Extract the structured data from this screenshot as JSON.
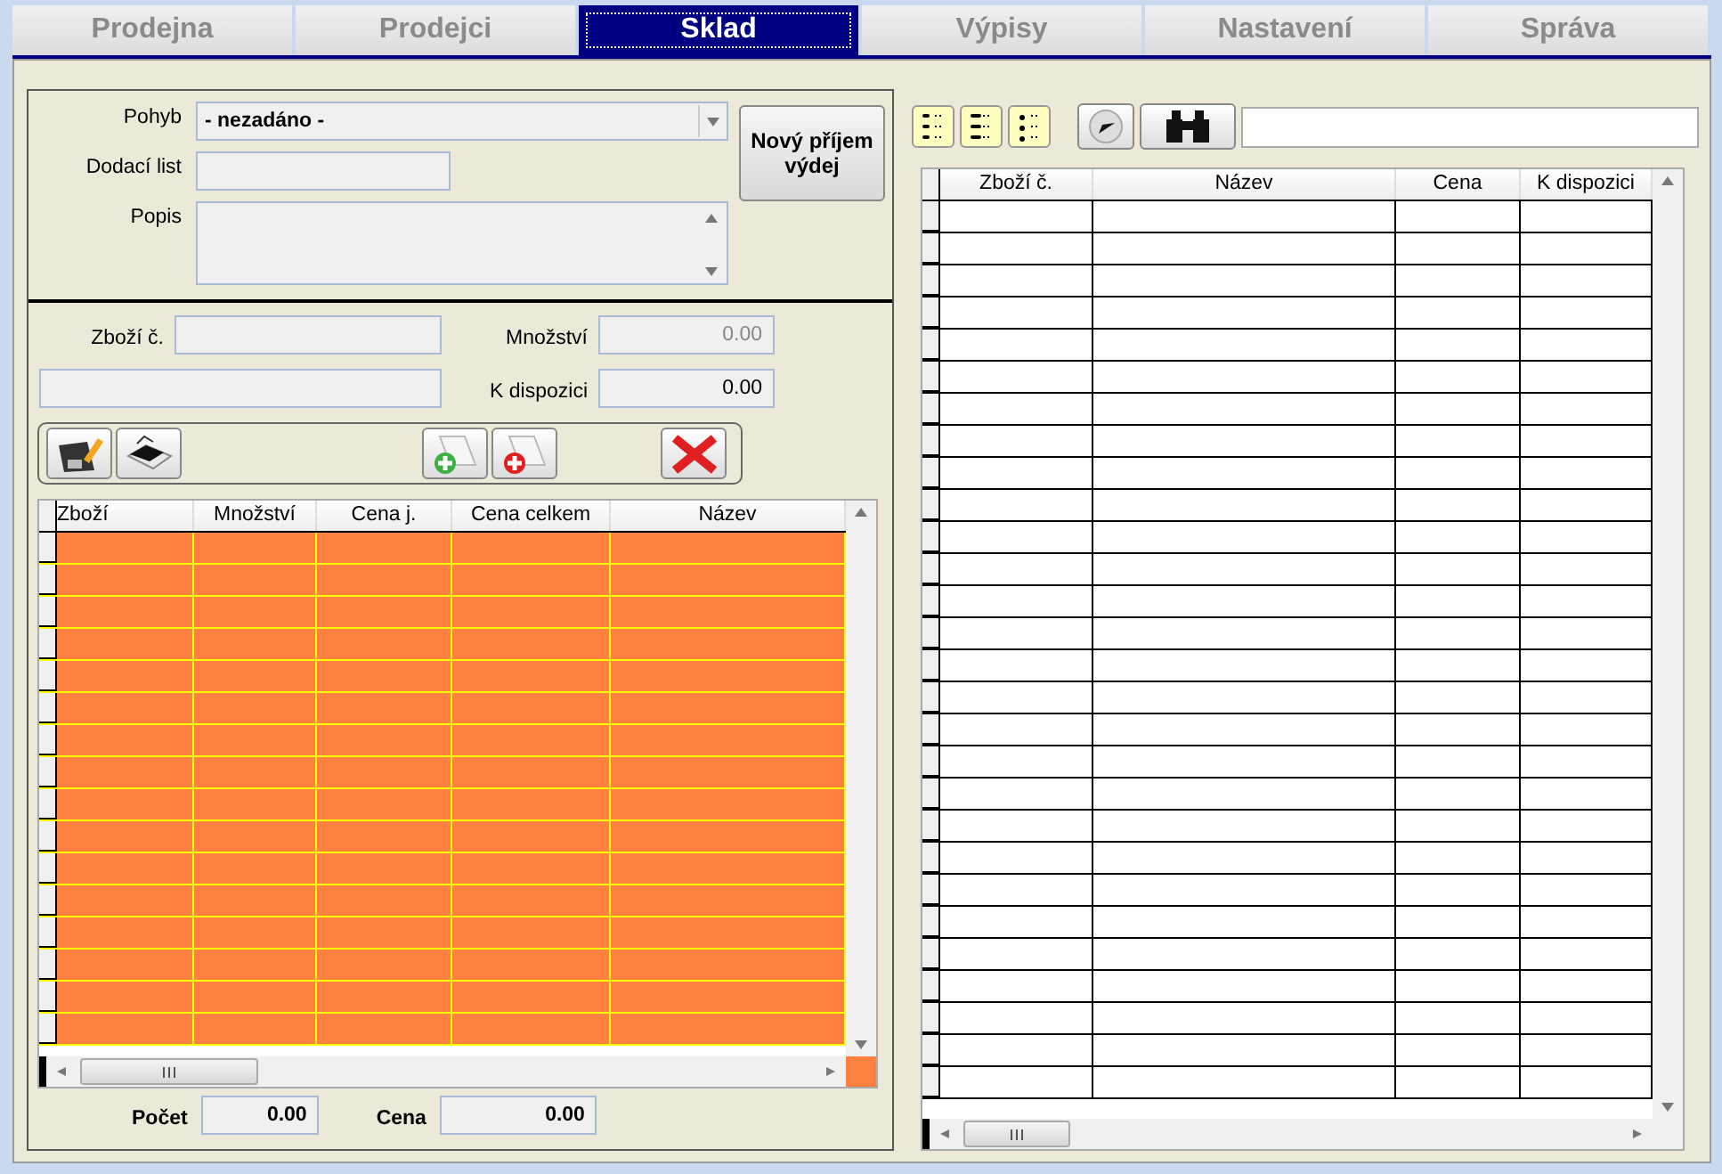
{
  "tabs": [
    {
      "label": "Prodejna",
      "selected": false
    },
    {
      "label": "Prodejci",
      "selected": false
    },
    {
      "label": "Sklad",
      "selected": true
    },
    {
      "label": "Výpisy",
      "selected": false
    },
    {
      "label": "Nastavení",
      "selected": false
    },
    {
      "label": "Správa",
      "selected": false
    }
  ],
  "movement_form": {
    "pohyb_label": "Pohyb",
    "pohyb_value": "- nezadáno -",
    "delivery_label": "Dodací list",
    "description_label": "Popis",
    "new_button": "Nový příjem výdej"
  },
  "item_form": {
    "item_label": "Zboží č.",
    "quantity_label": "Množství",
    "quantity_value": "0.00",
    "available_label": "K dispozici",
    "available_value": "0.00"
  },
  "items_table": {
    "columns": [
      "Zboží",
      "Množství",
      "Cena j.",
      "Cena celkem",
      "Název"
    ]
  },
  "totals": {
    "count_label": "Počet",
    "count_value": "0.00",
    "price_label": "Cena",
    "price_value": "0.00"
  },
  "stock_table": {
    "columns": [
      "Zboží č.",
      "Název",
      "Cena",
      "K dispozici"
    ]
  }
}
